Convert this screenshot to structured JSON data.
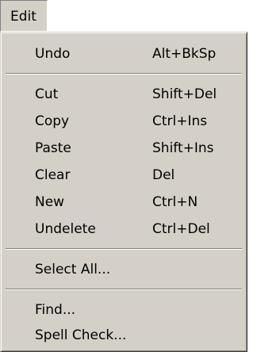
{
  "menubar": {
    "edit_label": "Edit"
  },
  "menu": {
    "items": [
      {
        "label": "Undo",
        "shortcut": "Alt+BkSp"
      },
      {
        "label": "Cut",
        "shortcut": "Shift+Del"
      },
      {
        "label": "Copy",
        "shortcut": "Ctrl+Ins"
      },
      {
        "label": "Paste",
        "shortcut": "Shift+Ins"
      },
      {
        "label": "Clear",
        "shortcut": "Del"
      },
      {
        "label": "New",
        "shortcut": "Ctrl+N"
      },
      {
        "label": "Undelete",
        "shortcut": "Ctrl+Del"
      },
      {
        "label": "Select All...",
        "shortcut": ""
      },
      {
        "label": "Find...",
        "shortcut": ""
      },
      {
        "label": "Spell Check...",
        "shortcut": ""
      }
    ]
  },
  "colors": {
    "menu_face": "#d4d0c8",
    "shadow": "#808080",
    "highlight": "#ffffff",
    "text": "#000000"
  }
}
